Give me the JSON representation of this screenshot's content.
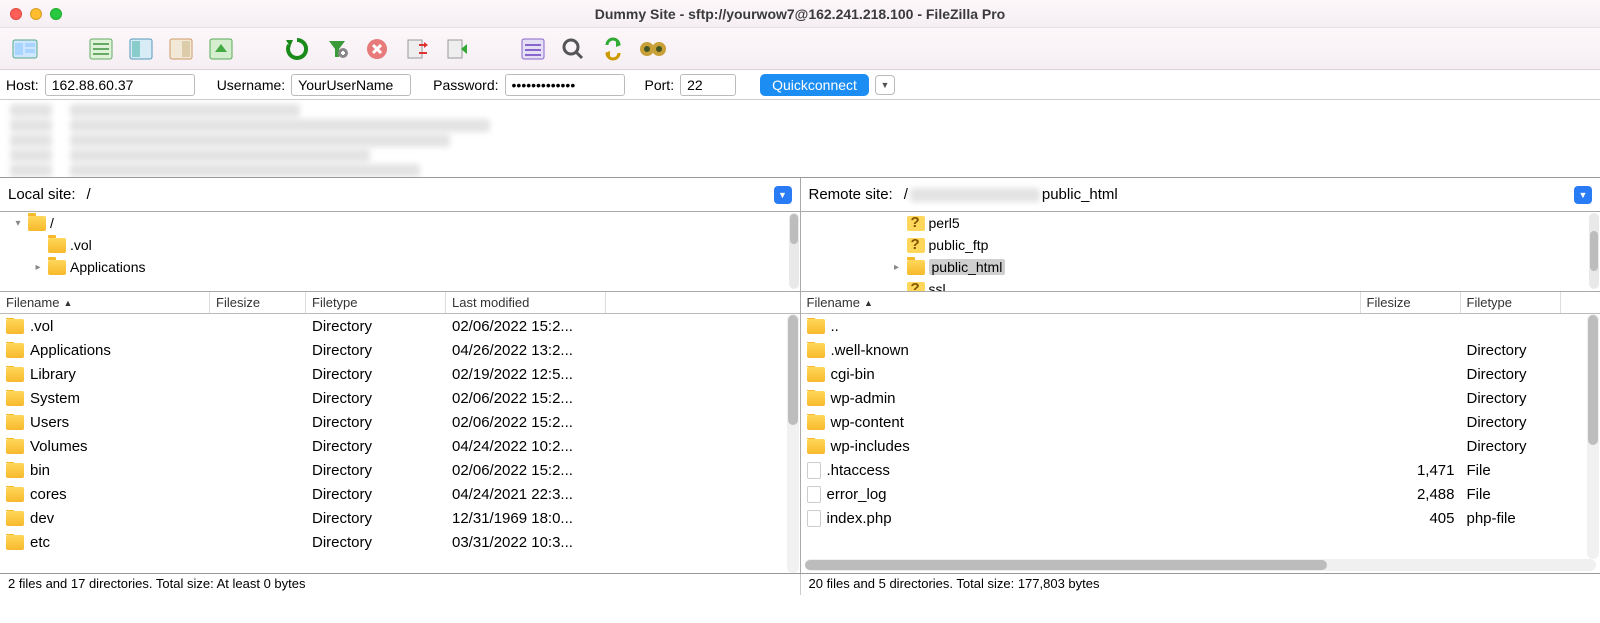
{
  "window": {
    "title": "Dummy Site - sftp://yourwow7@162.241.218.100 - FileZilla Pro"
  },
  "toolbar_icons": [
    "site-manager",
    "toggle-log",
    "toggle-local-tree",
    "toggle-remote-tree",
    "toggle-queue",
    "refresh",
    "filter",
    "cancel",
    "disconnect",
    "reconnect",
    "process-queue",
    "search",
    "sync-browse",
    "compare"
  ],
  "quickconnect": {
    "host_label": "Host:",
    "host": "162.88.60.37",
    "user_label": "Username:",
    "user": "YourUserName",
    "pass_label": "Password:",
    "pass": "•••••••••••••",
    "port_label": "Port:",
    "port": "22",
    "button": "Quickconnect"
  },
  "local": {
    "label": "Local site:",
    "path": "/",
    "tree": [
      {
        "indent": 0,
        "twist": "▾",
        "icon": "folder",
        "label": "/"
      },
      {
        "indent": 1,
        "twist": " ",
        "icon": "folder",
        "label": ".vol"
      },
      {
        "indent": 1,
        "twist": "▸",
        "icon": "folder",
        "label": "Applications"
      }
    ],
    "columns": [
      "Filename",
      "Filesize",
      "Filetype",
      "Last modified"
    ],
    "rows": [
      {
        "name": ".vol",
        "size": "",
        "type": "Directory",
        "mod": "02/06/2022 15:2..."
      },
      {
        "name": "Applications",
        "size": "",
        "type": "Directory",
        "mod": "04/26/2022 13:2..."
      },
      {
        "name": "Library",
        "size": "",
        "type": "Directory",
        "mod": "02/19/2022 12:5..."
      },
      {
        "name": "System",
        "size": "",
        "type": "Directory",
        "mod": "02/06/2022 15:2..."
      },
      {
        "name": "Users",
        "size": "",
        "type": "Directory",
        "mod": "02/06/2022 15:2..."
      },
      {
        "name": "Volumes",
        "size": "",
        "type": "Directory",
        "mod": "04/24/2022 10:2..."
      },
      {
        "name": "bin",
        "size": "",
        "type": "Directory",
        "mod": "02/06/2022 15:2..."
      },
      {
        "name": "cores",
        "size": "",
        "type": "Directory",
        "mod": "04/24/2021 22:3..."
      },
      {
        "name": "dev",
        "size": "",
        "type": "Directory",
        "mod": "12/31/1969 18:0..."
      },
      {
        "name": "etc",
        "size": "",
        "type": "Directory",
        "mod": "03/31/2022 10:3..."
      }
    ],
    "status": "2 files and 17 directories. Total size: At least 0 bytes"
  },
  "remote": {
    "label": "Remote site:",
    "path_prefix": "/",
    "path_suffix": "public_html",
    "tree": [
      {
        "indent": 0,
        "twist": " ",
        "icon": "folderq",
        "label": "perl5"
      },
      {
        "indent": 0,
        "twist": " ",
        "icon": "folderq",
        "label": "public_ftp"
      },
      {
        "indent": 0,
        "twist": "▸",
        "icon": "folder",
        "label": "public_html",
        "selected": true
      },
      {
        "indent": 0,
        "twist": " ",
        "icon": "folderq",
        "label": "ssl"
      }
    ],
    "columns": [
      "Filename",
      "Filesize",
      "Filetype"
    ],
    "rows": [
      {
        "icon": "folder",
        "name": "..",
        "size": "",
        "type": ""
      },
      {
        "icon": "folder",
        "name": ".well-known",
        "size": "",
        "type": "Directory"
      },
      {
        "icon": "folder",
        "name": "cgi-bin",
        "size": "",
        "type": "Directory"
      },
      {
        "icon": "folder",
        "name": "wp-admin",
        "size": "",
        "type": "Directory"
      },
      {
        "icon": "folder",
        "name": "wp-content",
        "size": "",
        "type": "Directory"
      },
      {
        "icon": "folder",
        "name": "wp-includes",
        "size": "",
        "type": "Directory"
      },
      {
        "icon": "file",
        "name": ".htaccess",
        "size": "1,471",
        "type": "File"
      },
      {
        "icon": "file",
        "name": "error_log",
        "size": "2,488",
        "type": "File"
      },
      {
        "icon": "file",
        "name": "index.php",
        "size": "405",
        "type": "php-file"
      }
    ],
    "status": "20 files and 5 directories. Total size: 177,803 bytes"
  }
}
